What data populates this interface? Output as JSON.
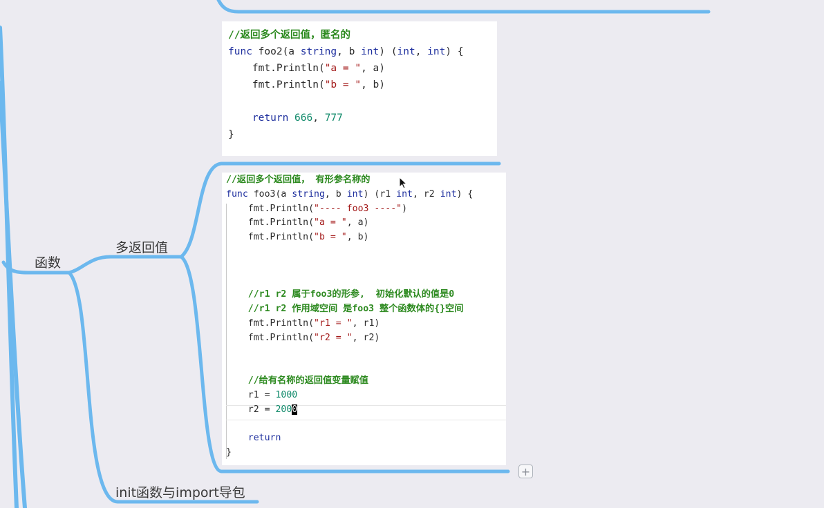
{
  "mindmap": {
    "root_label": "函数",
    "branch_multi_return": "多返回值",
    "branch_init": "init函数与import导包"
  },
  "card_foo2": {
    "lines": [
      [
        {
          "t": "//返回多个返回值，匿名的",
          "c": "cm"
        }
      ],
      [
        {
          "t": "func ",
          "c": "kw"
        },
        {
          "t": "foo2(a ",
          "c": "pun"
        },
        {
          "t": "string",
          "c": "kw"
        },
        {
          "t": ", b ",
          "c": "pun"
        },
        {
          "t": "int",
          "c": "kw"
        },
        {
          "t": ") (",
          "c": "pun"
        },
        {
          "t": "int",
          "c": "kw"
        },
        {
          "t": ", ",
          "c": "pun"
        },
        {
          "t": "int",
          "c": "kw"
        },
        {
          "t": ") {",
          "c": "pun"
        }
      ],
      [
        {
          "t": "    fmt.Println(",
          "c": "pun"
        },
        {
          "t": "\"a = \"",
          "c": "str"
        },
        {
          "t": ", a)",
          "c": "pun"
        }
      ],
      [
        {
          "t": "    fmt.Println(",
          "c": "pun"
        },
        {
          "t": "\"b = \"",
          "c": "str"
        },
        {
          "t": ", b)",
          "c": "pun"
        }
      ],
      [],
      [
        {
          "t": "    ",
          "c": "pun"
        },
        {
          "t": "return ",
          "c": "kw"
        },
        {
          "t": "666",
          "c": "num"
        },
        {
          "t": ", ",
          "c": "pun"
        },
        {
          "t": "777",
          "c": "num"
        }
      ],
      [
        {
          "t": "}",
          "c": "pun"
        }
      ]
    ]
  },
  "card_foo3": {
    "lines": [
      [
        {
          "t": "//返回多个返回值， 有形参名称的",
          "c": "cm"
        }
      ],
      [
        {
          "t": "func ",
          "c": "kw"
        },
        {
          "t": "foo3(a ",
          "c": "pun"
        },
        {
          "t": "string",
          "c": "kw"
        },
        {
          "t": ", b ",
          "c": "pun"
        },
        {
          "t": "int",
          "c": "kw"
        },
        {
          "t": ") (r1 ",
          "c": "pun"
        },
        {
          "t": "int",
          "c": "kw"
        },
        {
          "t": ", r2 ",
          "c": "pun"
        },
        {
          "t": "int",
          "c": "kw"
        },
        {
          "t": ") {",
          "c": "pun"
        }
      ],
      [
        {
          "t": "    fmt.Println(",
          "c": "pun"
        },
        {
          "t": "\"---- foo3 ----\"",
          "c": "str"
        },
        {
          "t": ")",
          "c": "pun"
        }
      ],
      [
        {
          "t": "    fmt.Println(",
          "c": "pun"
        },
        {
          "t": "\"a = \"",
          "c": "str"
        },
        {
          "t": ", a)",
          "c": "pun"
        }
      ],
      [
        {
          "t": "    fmt.Println(",
          "c": "pun"
        },
        {
          "t": "\"b = \"",
          "c": "str"
        },
        {
          "t": ", b)",
          "c": "pun"
        }
      ],
      [],
      [],
      [],
      [
        {
          "t": "    //r1 r2 属于foo3的形参,  初始化默认的值是0",
          "c": "cm"
        }
      ],
      [
        {
          "t": "    //r1 r2 作用域空间 是foo3 整个函数体的{}空间",
          "c": "cm"
        }
      ],
      [
        {
          "t": "    fmt.Println(",
          "c": "pun"
        },
        {
          "t": "\"r1 = \"",
          "c": "str"
        },
        {
          "t": ", r1)",
          "c": "pun"
        }
      ],
      [
        {
          "t": "    fmt.Println(",
          "c": "pun"
        },
        {
          "t": "\"r2 = \"",
          "c": "str"
        },
        {
          "t": ", r2)",
          "c": "pun"
        }
      ],
      [],
      [],
      [
        {
          "t": "    //给有名称的返回值变量赋值",
          "c": "cm"
        }
      ],
      [
        {
          "t": "    r1 = ",
          "c": "pun"
        },
        {
          "t": "1000",
          "c": "num"
        }
      ],
      [
        {
          "t": "    r2 = ",
          "c": "pun"
        },
        {
          "t": "200",
          "c": "num"
        },
        {
          "t": "0",
          "c": "num cur-bg"
        }
      ],
      [],
      [
        {
          "t": "    ",
          "c": "pun"
        },
        {
          "t": "return",
          "c": "kw"
        }
      ],
      [
        {
          "t": "}",
          "c": "pun"
        }
      ]
    ]
  },
  "add_button_label": "+",
  "icons": {
    "add": "plus-icon",
    "pointer": "mouse-cursor-icon"
  },
  "colors": {
    "connector": "#6cb8ee",
    "background": "#ecebf1",
    "comment": "#2d8a20",
    "keyword": "#1e2f9e",
    "string": "#a31919",
    "number": "#108a6a"
  }
}
